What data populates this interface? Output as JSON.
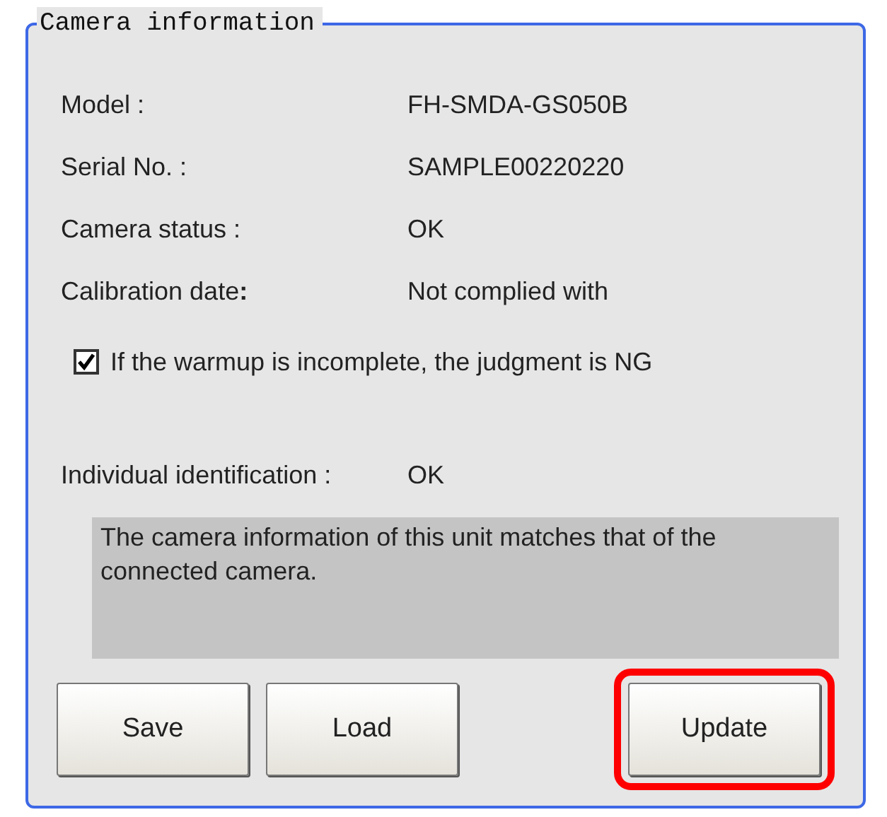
{
  "group": {
    "title": "Camera information"
  },
  "fields": [
    {
      "label": "Model :",
      "value": "FH-SMDA-GS050B"
    },
    {
      "label": "Serial No. :",
      "value": "SAMPLE00220220"
    },
    {
      "label": "Camera status :",
      "value": "OK"
    },
    {
      "label": "Calibration date",
      "label_suffix": ":",
      "value": "Not complied with"
    }
  ],
  "warmup_checkbox": {
    "label": "If the warmup is incomplete, the judgment is NG",
    "checked": true
  },
  "identification": {
    "label": "Individual identification :",
    "value": "OK"
  },
  "message": "The camera information of this unit matches that of the connected camera.",
  "buttons": [
    {
      "label": "Save",
      "highlighted": false
    },
    {
      "label": "Load",
      "highlighted": false
    },
    {
      "label": "Update",
      "highlighted": true
    }
  ]
}
